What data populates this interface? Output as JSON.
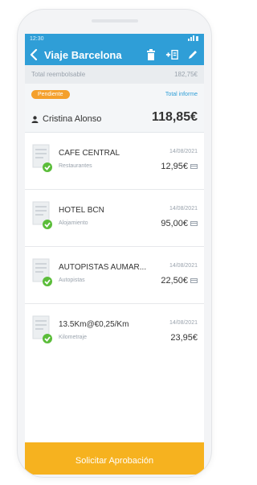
{
  "status": {
    "time": "12:30"
  },
  "appbar": {
    "title": "Viaje Barcelona"
  },
  "summary": {
    "label": "Total reembolsable",
    "value": "182,75€"
  },
  "header": {
    "badge": "Pendiente",
    "total_label": "Total informe",
    "user": "Cristina Alonso",
    "total_amount": "118,85€"
  },
  "expenses": [
    {
      "name": "CAFÉ CENTRAL",
      "category": "Restaurantes",
      "date": "14/08/2021",
      "amount": "12,95€"
    },
    {
      "name": "HOTEL BCN",
      "category": "Alojamiento",
      "date": "14/08/2021",
      "amount": "95,00€"
    },
    {
      "name": "AUTOPISTAS AUMAR...",
      "category": "Autopistas",
      "date": "14/08/2021",
      "amount": "22,50€"
    },
    {
      "name": "13.5Km@€0,25/Km",
      "category": "Kilometraje",
      "date": "14/08/2021",
      "amount": "23,95€"
    }
  ],
  "cta": {
    "label": "Solicitar Aprobación"
  },
  "colors": {
    "primary": "#2f9ed7",
    "accent": "#f6b21f",
    "badge": "#f4a02c",
    "success": "#5bbd3a"
  }
}
